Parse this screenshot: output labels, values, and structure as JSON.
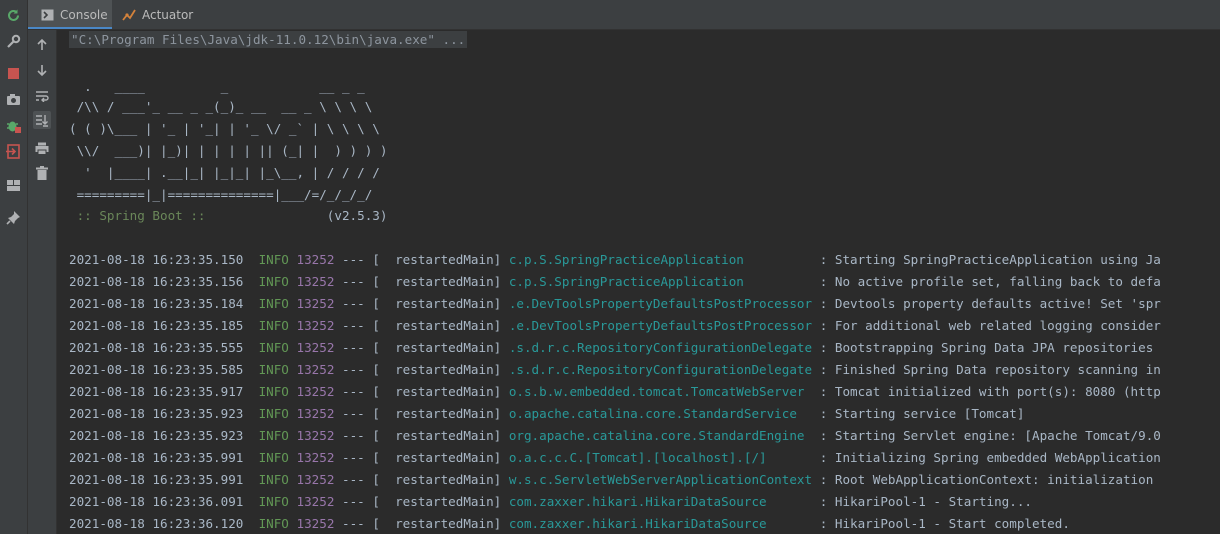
{
  "tabs": [
    {
      "label": "Console",
      "icon": "console-icon",
      "active": true
    },
    {
      "label": "Actuator",
      "icon": "actuator-icon",
      "active": false
    }
  ],
  "toolbar_icons": [
    "rerun-icon",
    "settings-wrench-icon",
    "stop-icon",
    "camera-snapshot-icon",
    "debug-bug-icon",
    "exit-icon",
    "layout-icon",
    "pin-icon"
  ],
  "side_action_icons": [
    "scroll-up-icon",
    "scroll-down-icon",
    "soft-wrap-icon",
    "scroll-to-end-icon",
    "print-icon",
    "trash-icon"
  ],
  "console": {
    "command": "\"C:\\Program Files\\Java\\jdk-11.0.12\\bin\\java.exe\" ...",
    "banner": [
      "  .   ____          _            __ _ _",
      " /\\\\ / ___'_ __ _ _(_)_ __  __ _ \\ \\ \\ \\",
      "( ( )\\___ | '_ | '_| | '_ \\/ _` | \\ \\ \\ \\",
      " \\\\/  ___)| |_)| | | | | || (_| |  ) ) ) )",
      "  '  |____| .__|_| |_|_| |_\\__, | / / / /",
      " =========|_|==============|___/=/_/_/_/"
    ],
    "spring_boot_label": " :: Spring Boot :: ",
    "spring_boot_version": "               (v2.5.3)",
    "logs": [
      {
        "ts": "2021-08-18 16:23:35.150",
        "level": "INFO",
        "pid": "13252",
        "sep": " --- [  restartedMain] ",
        "logger": "c.p.S.SpringPracticeApplication         ",
        "msg": " : Starting SpringPracticeApplication using Ja"
      },
      {
        "ts": "2021-08-18 16:23:35.156",
        "level": "INFO",
        "pid": "13252",
        "sep": " --- [  restartedMain] ",
        "logger": "c.p.S.SpringPracticeApplication         ",
        "msg": " : No active profile set, falling back to defa"
      },
      {
        "ts": "2021-08-18 16:23:35.184",
        "level": "INFO",
        "pid": "13252",
        "sep": " --- [  restartedMain] ",
        "logger": ".e.DevToolsPropertyDefaultsPostProcessor",
        "msg": " : Devtools property defaults active! Set 'spr"
      },
      {
        "ts": "2021-08-18 16:23:35.185",
        "level": "INFO",
        "pid": "13252",
        "sep": " --- [  restartedMain] ",
        "logger": ".e.DevToolsPropertyDefaultsPostProcessor",
        "msg": " : For additional web related logging consider"
      },
      {
        "ts": "2021-08-18 16:23:35.555",
        "level": "INFO",
        "pid": "13252",
        "sep": " --- [  restartedMain] ",
        "logger": ".s.d.r.c.RepositoryConfigurationDelegate",
        "msg": " : Bootstrapping Spring Data JPA repositories "
      },
      {
        "ts": "2021-08-18 16:23:35.585",
        "level": "INFO",
        "pid": "13252",
        "sep": " --- [  restartedMain] ",
        "logger": ".s.d.r.c.RepositoryConfigurationDelegate",
        "msg": " : Finished Spring Data repository scanning in"
      },
      {
        "ts": "2021-08-18 16:23:35.917",
        "level": "INFO",
        "pid": "13252",
        "sep": " --- [  restartedMain] ",
        "logger": "o.s.b.w.embedded.tomcat.TomcatWebServer ",
        "msg": " : Tomcat initialized with port(s): 8080 (http"
      },
      {
        "ts": "2021-08-18 16:23:35.923",
        "level": "INFO",
        "pid": "13252",
        "sep": " --- [  restartedMain] ",
        "logger": "o.apache.catalina.core.StandardService  ",
        "msg": " : Starting service [Tomcat]"
      },
      {
        "ts": "2021-08-18 16:23:35.923",
        "level": "INFO",
        "pid": "13252",
        "sep": " --- [  restartedMain] ",
        "logger": "org.apache.catalina.core.StandardEngine ",
        "msg": " : Starting Servlet engine: [Apache Tomcat/9.0"
      },
      {
        "ts": "2021-08-18 16:23:35.991",
        "level": "INFO",
        "pid": "13252",
        "sep": " --- [  restartedMain] ",
        "logger": "o.a.c.c.C.[Tomcat].[localhost].[/]      ",
        "msg": " : Initializing Spring embedded WebApplication"
      },
      {
        "ts": "2021-08-18 16:23:35.991",
        "level": "INFO",
        "pid": "13252",
        "sep": " --- [  restartedMain] ",
        "logger": "w.s.c.ServletWebServerApplicationContext",
        "msg": " : Root WebApplicationContext: initialization "
      },
      {
        "ts": "2021-08-18 16:23:36.091",
        "level": "INFO",
        "pid": "13252",
        "sep": " --- [  restartedMain] ",
        "logger": "com.zaxxer.hikari.HikariDataSource      ",
        "msg": " : HikariPool-1 - Starting..."
      },
      {
        "ts": "2021-08-18 16:23:36.120",
        "level": "INFO",
        "pid": "13252",
        "sep": " --- [  restartedMain] ",
        "logger": "com.zaxxer.hikari.HikariDataSource      ",
        "msg": " : HikariPool-1 - Start completed."
      }
    ]
  },
  "colors": {
    "background": "#2b2b2b",
    "panel": "#3c3f41",
    "text": "#a9b7c6",
    "info": "#629755",
    "pid": "#9876aa",
    "logger": "#299999",
    "spring": "#6a8759",
    "tab_underline": "#4a88c7"
  }
}
